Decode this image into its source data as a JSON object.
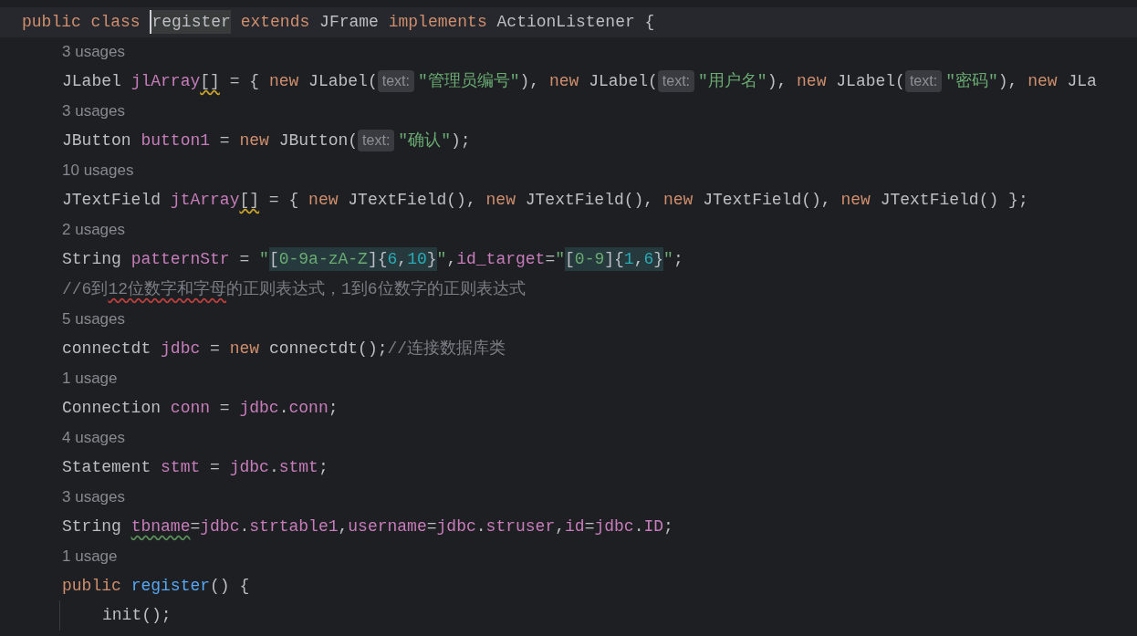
{
  "editor": {
    "lines": [
      {
        "kind": "code",
        "current": true,
        "tokens": [
          {
            "kind": "keyword",
            "s": "public class "
          },
          {
            "kind": "plain",
            "s": "register",
            "caret": true,
            "highlighted": true
          },
          {
            "kind": "keyword",
            "s": " extends "
          },
          {
            "kind": "plain",
            "s": "JFrame "
          },
          {
            "kind": "keyword",
            "s": "implements "
          },
          {
            "kind": "plain",
            "s": "ActionListener {"
          }
        ],
        "children": [
          {
            "kind": "usages",
            "text": "3 usages"
          },
          {
            "kind": "code",
            "tokens": [
              {
                "kind": "plain",
                "s": "JLabel "
              },
              {
                "kind": "field",
                "s": "jlArray"
              },
              {
                "kind": "plain",
                "s": "[]",
                "warning": true
              },
              {
                "kind": "plain",
                "s": " = { "
              },
              {
                "kind": "keyword",
                "s": "new "
              },
              {
                "kind": "plain",
                "s": "JLabel("
              },
              {
                "kind": "hint",
                "s": "text:"
              },
              {
                "kind": "string",
                "s": "\"管理员编号\""
              },
              {
                "kind": "plain",
                "s": "), "
              },
              {
                "kind": "keyword",
                "s": "new "
              },
              {
                "kind": "plain",
                "s": "JLabel("
              },
              {
                "kind": "hint",
                "s": "text:"
              },
              {
                "kind": "string",
                "s": "\"用户名\""
              },
              {
                "kind": "plain",
                "s": "), "
              },
              {
                "kind": "keyword",
                "s": "new "
              },
              {
                "kind": "plain",
                "s": "JLabel("
              },
              {
                "kind": "hint",
                "s": "text:"
              },
              {
                "kind": "string",
                "s": "\"密码\""
              },
              {
                "kind": "plain",
                "s": "), "
              },
              {
                "kind": "keyword",
                "s": "new "
              },
              {
                "kind": "plain",
                "s": "JLa"
              }
            ]
          },
          {
            "kind": "usages",
            "text": "3 usages"
          },
          {
            "kind": "code",
            "tokens": [
              {
                "kind": "plain",
                "s": "JButton "
              },
              {
                "kind": "field",
                "s": "button1"
              },
              {
                "kind": "plain",
                "s": " = "
              },
              {
                "kind": "keyword",
                "s": "new "
              },
              {
                "kind": "plain",
                "s": "JButton("
              },
              {
                "kind": "hint",
                "s": "text:"
              },
              {
                "kind": "string",
                "s": "\"确认\""
              },
              {
                "kind": "plain",
                "s": ");"
              }
            ]
          },
          {
            "kind": "usages",
            "text": "10 usages"
          },
          {
            "kind": "code",
            "tokens": [
              {
                "kind": "plain",
                "s": "JTextField "
              },
              {
                "kind": "field",
                "s": "jtArray"
              },
              {
                "kind": "plain",
                "s": "[]",
                "warning": true
              },
              {
                "kind": "plain",
                "s": " = { "
              },
              {
                "kind": "keyword",
                "s": "new "
              },
              {
                "kind": "plain",
                "s": "JTextField(), "
              },
              {
                "kind": "keyword",
                "s": "new "
              },
              {
                "kind": "plain",
                "s": "JTextField(), "
              },
              {
                "kind": "keyword",
                "s": "new "
              },
              {
                "kind": "plain",
                "s": "JTextField(), "
              },
              {
                "kind": "keyword",
                "s": "new "
              },
              {
                "kind": "plain",
                "s": "JTextField() };"
              }
            ]
          },
          {
            "kind": "usages",
            "text": "2 usages"
          },
          {
            "kind": "code",
            "tokens": [
              {
                "kind": "plain",
                "s": "String "
              },
              {
                "kind": "field",
                "s": "patternStr"
              },
              {
                "kind": "plain",
                "s": " = "
              },
              {
                "kind": "string",
                "s": "\""
              },
              {
                "kind": "regex",
                "s": "[",
                "injected": true
              },
              {
                "kind": "string",
                "s": "0-9a-zA-Z",
                "injected": true
              },
              {
                "kind": "regex",
                "s": "]{",
                "injected": true
              },
              {
                "kind": "number",
                "s": "6",
                "injected": true
              },
              {
                "kind": "regex",
                "s": ",",
                "injected": true
              },
              {
                "kind": "number",
                "s": "10",
                "injected": true
              },
              {
                "kind": "regex",
                "s": "}",
                "injected": true
              },
              {
                "kind": "string",
                "s": "\""
              },
              {
                "kind": "plain",
                "s": ","
              },
              {
                "kind": "field",
                "s": "id_target"
              },
              {
                "kind": "plain",
                "s": "="
              },
              {
                "kind": "string",
                "s": "\""
              },
              {
                "kind": "regex",
                "s": "[",
                "injected": true
              },
              {
                "kind": "string",
                "s": "0-9",
                "injected": true
              },
              {
                "kind": "regex",
                "s": "]{",
                "injected": true
              },
              {
                "kind": "number",
                "s": "1",
                "injected": true
              },
              {
                "kind": "regex",
                "s": ",",
                "injected": true
              },
              {
                "kind": "number",
                "s": "6",
                "injected": true
              },
              {
                "kind": "regex",
                "s": "}",
                "injected": true
              },
              {
                "kind": "string",
                "s": "\""
              },
              {
                "kind": "plain",
                "s": ";"
              }
            ]
          },
          {
            "kind": "code",
            "tokens": [
              {
                "kind": "comment",
                "s": "//6到"
              },
              {
                "kind": "comment",
                "s": "12位数字和字母",
                "typo": true
              },
              {
                "kind": "comment",
                "s": "的正则表达式，1到6位数字的正则表达式"
              }
            ]
          },
          {
            "kind": "usages",
            "text": "5 usages"
          },
          {
            "kind": "code",
            "tokens": [
              {
                "kind": "plain",
                "s": "connectdt "
              },
              {
                "kind": "field",
                "s": "jdbc"
              },
              {
                "kind": "plain",
                "s": " = "
              },
              {
                "kind": "keyword",
                "s": "new "
              },
              {
                "kind": "plain",
                "s": "connectdt();"
              },
              {
                "kind": "comment",
                "s": "//连接数据库类"
              }
            ]
          },
          {
            "kind": "usages",
            "text": "1 usage"
          },
          {
            "kind": "code",
            "tokens": [
              {
                "kind": "plain",
                "s": "Connection "
              },
              {
                "kind": "field",
                "s": "conn"
              },
              {
                "kind": "plain",
                "s": " = "
              },
              {
                "kind": "field",
                "s": "jdbc"
              },
              {
                "kind": "plain",
                "s": "."
              },
              {
                "kind": "field",
                "s": "conn"
              },
              {
                "kind": "plain",
                "s": ";"
              }
            ]
          },
          {
            "kind": "usages",
            "text": "4 usages"
          },
          {
            "kind": "code",
            "tokens": [
              {
                "kind": "plain",
                "s": "Statement "
              },
              {
                "kind": "field",
                "s": "stmt"
              },
              {
                "kind": "plain",
                "s": " = "
              },
              {
                "kind": "field",
                "s": "jdbc"
              },
              {
                "kind": "plain",
                "s": "."
              },
              {
                "kind": "field",
                "s": "stmt"
              },
              {
                "kind": "plain",
                "s": ";"
              }
            ]
          },
          {
            "kind": "usages",
            "text": "3 usages"
          },
          {
            "kind": "code",
            "tokens": [
              {
                "kind": "plain",
                "s": "String "
              },
              {
                "kind": "field",
                "s": "tbname",
                "grammar": true
              },
              {
                "kind": "plain",
                "s": "="
              },
              {
                "kind": "field",
                "s": "jdbc"
              },
              {
                "kind": "plain",
                "s": "."
              },
              {
                "kind": "field",
                "s": "strtable1"
              },
              {
                "kind": "plain",
                "s": ","
              },
              {
                "kind": "field",
                "s": "username"
              },
              {
                "kind": "plain",
                "s": "="
              },
              {
                "kind": "field",
                "s": "jdbc"
              },
              {
                "kind": "plain",
                "s": "."
              },
              {
                "kind": "field",
                "s": "struser"
              },
              {
                "kind": "plain",
                "s": ","
              },
              {
                "kind": "field",
                "s": "id"
              },
              {
                "kind": "plain",
                "s": "="
              },
              {
                "kind": "field",
                "s": "jdbc"
              },
              {
                "kind": "plain",
                "s": "."
              },
              {
                "kind": "field",
                "s": "ID"
              },
              {
                "kind": "plain",
                "s": ";"
              }
            ]
          },
          {
            "kind": "usages",
            "text": "1 usage"
          },
          {
            "kind": "code",
            "tokens": [
              {
                "kind": "keyword",
                "s": "public "
              },
              {
                "kind": "method",
                "s": "register"
              },
              {
                "kind": "plain",
                "s": "() {"
              }
            ],
            "children": [
              {
                "kind": "code",
                "tokens": [
                  {
                    "kind": "plain",
                    "s": "init();"
                  }
                ]
              }
            ]
          }
        ]
      }
    ]
  }
}
